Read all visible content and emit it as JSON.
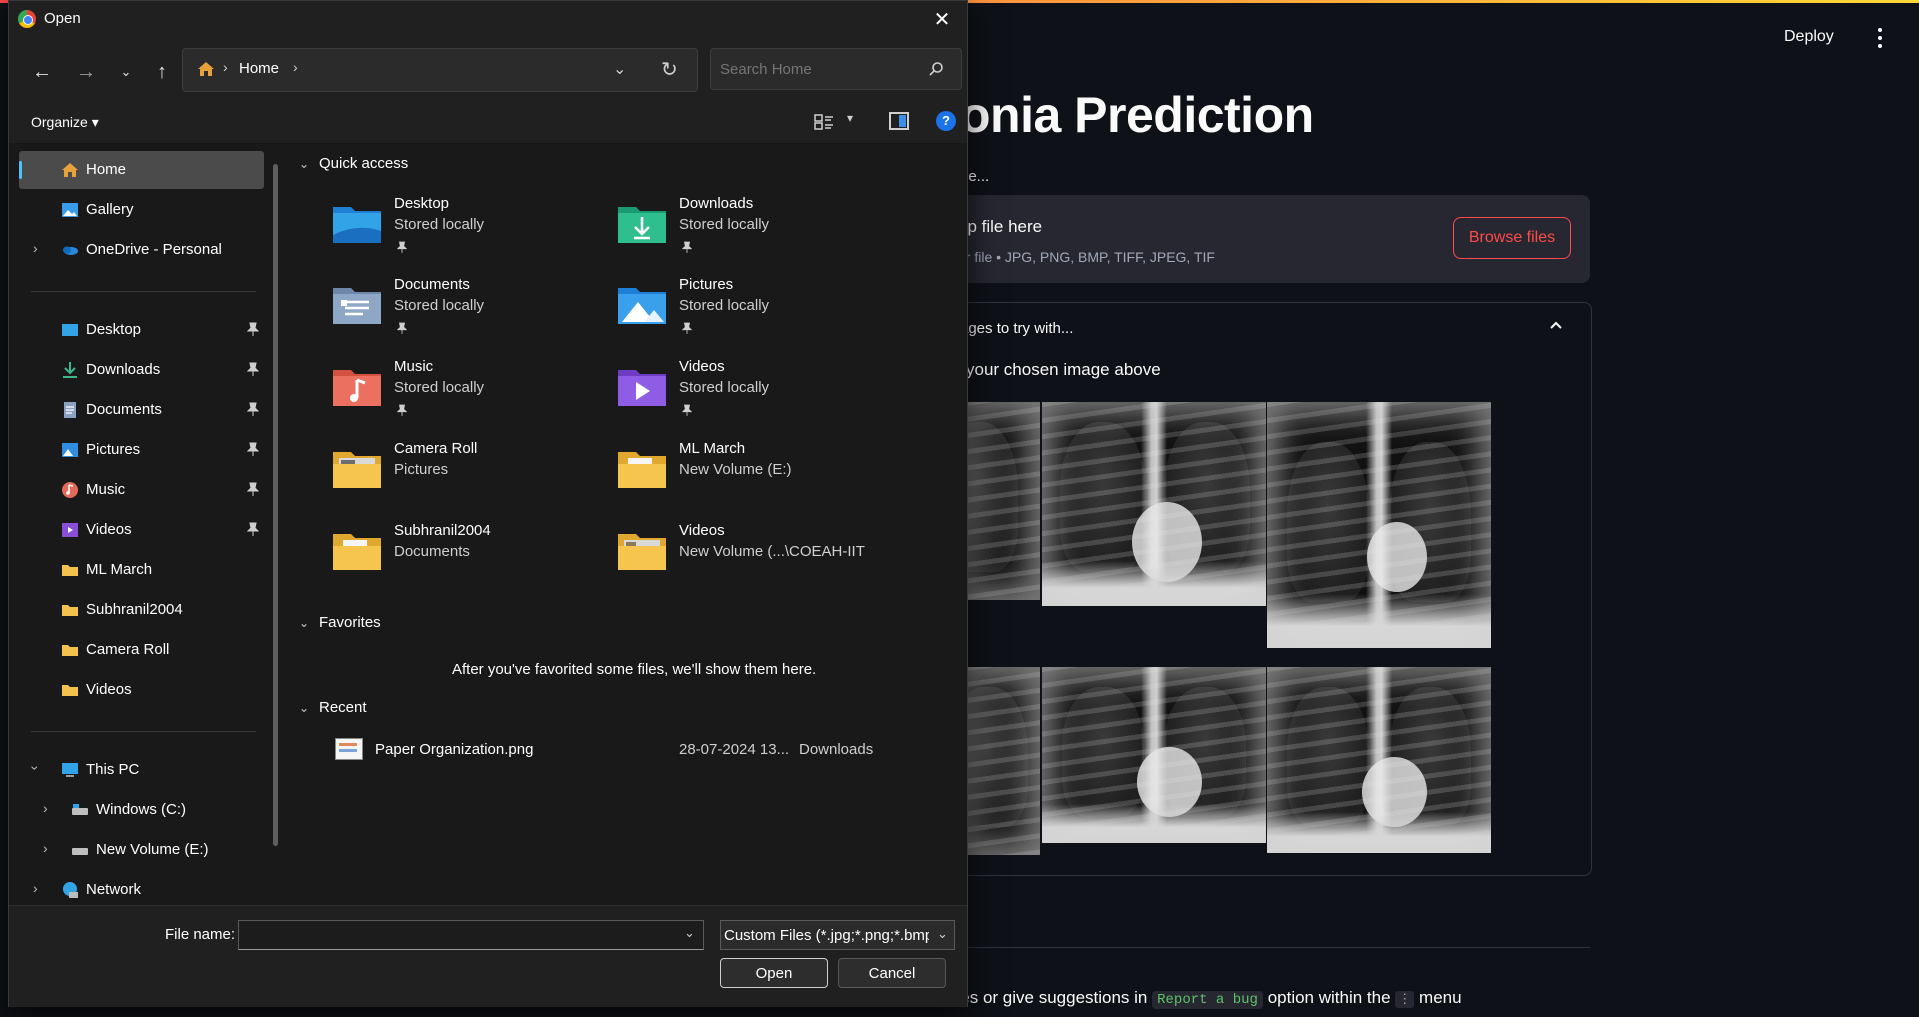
{
  "browser_app": {
    "deploy_label": "Deploy",
    "title": "onia Prediction",
    "caption": "ge...",
    "uploader": {
      "drop_text": "op file here",
      "limit_text": "er file • JPG, PNG, BMP, TIFF, JPEG, TIF",
      "browse_label": "Browse files"
    },
    "expander": {
      "header": "ages to try with...",
      "subtitle": "your chosen image above"
    },
    "footer": {
      "text_before": "cies or give suggestions in",
      "code": "Report a bug",
      "text_middle": "option within the",
      "kbd": "⋮",
      "text_after": "menu"
    },
    "accent_color": "#ff4b4b"
  },
  "dialog": {
    "title": "Open",
    "address": {
      "crumb": "Home"
    },
    "search": {
      "placeholder": "Search Home"
    },
    "organize_label": "Organize",
    "nav": {
      "quick": [
        {
          "label": "Home",
          "icon": "home-icon"
        },
        {
          "label": "Gallery",
          "icon": "gallery-icon"
        },
        {
          "label": "OneDrive - Personal",
          "icon": "onedrive-icon"
        }
      ],
      "pinned": [
        {
          "label": "Desktop",
          "icon": "desktop-icon"
        },
        {
          "label": "Downloads",
          "icon": "downloads-icon"
        },
        {
          "label": "Documents",
          "icon": "documents-icon"
        },
        {
          "label": "Pictures",
          "icon": "pictures-icon"
        },
        {
          "label": "Music",
          "icon": "music-icon"
        },
        {
          "label": "Videos",
          "icon": "videos-icon"
        }
      ],
      "folders": [
        {
          "label": "ML March"
        },
        {
          "label": "Subhranil2004"
        },
        {
          "label": "Camera Roll"
        },
        {
          "label": "Videos"
        }
      ],
      "tree": [
        {
          "label": "This PC",
          "icon": "this-pc-icon"
        },
        {
          "label": "Windows (C:)",
          "icon": "drive-icon"
        },
        {
          "label": "New Volume (E:)",
          "icon": "drive-icon"
        },
        {
          "label": "Network",
          "icon": "network-icon"
        }
      ]
    },
    "sections": {
      "quick_access": "Quick access",
      "favorites": "Favorites",
      "recent": "Recent"
    },
    "quick_access": [
      {
        "name": "Desktop",
        "sub": "Stored locally",
        "pinned": true,
        "icon": "desktop-folder-icon"
      },
      {
        "name": "Downloads",
        "sub": "Stored locally",
        "pinned": true,
        "icon": "downloads-folder-icon"
      },
      {
        "name": "Documents",
        "sub": "Stored locally",
        "pinned": true,
        "icon": "documents-folder-icon"
      },
      {
        "name": "Pictures",
        "sub": "Stored locally",
        "pinned": true,
        "icon": "pictures-folder-icon"
      },
      {
        "name": "Music",
        "sub": "Stored locally",
        "pinned": true,
        "icon": "music-folder-icon"
      },
      {
        "name": "Videos",
        "sub": "Stored locally",
        "pinned": true,
        "icon": "videos-folder-icon"
      },
      {
        "name": "Camera Roll",
        "sub": "Pictures",
        "pinned": false,
        "icon": "folder-icon"
      },
      {
        "name": "ML March",
        "sub": "New Volume (E:)",
        "pinned": false,
        "icon": "folder-icon"
      },
      {
        "name": "Subhranil2004",
        "sub": "Documents",
        "pinned": false,
        "icon": "folder-icon"
      },
      {
        "name": "Videos",
        "sub": "New Volume (...\\COEAH-IIT",
        "pinned": false,
        "icon": "folder-icon"
      }
    ],
    "favorites_empty": "After you've favorited some files, we'll show them here.",
    "recent": [
      {
        "name": "Paper Organization.png",
        "date": "28-07-2024 13...",
        "location": "Downloads"
      }
    ],
    "file_name_label": "File name:",
    "file_name_value": "",
    "file_type": "Custom Files (*.jpg;*.png;*.bmp;",
    "open_label": "Open",
    "cancel_label": "Cancel"
  }
}
